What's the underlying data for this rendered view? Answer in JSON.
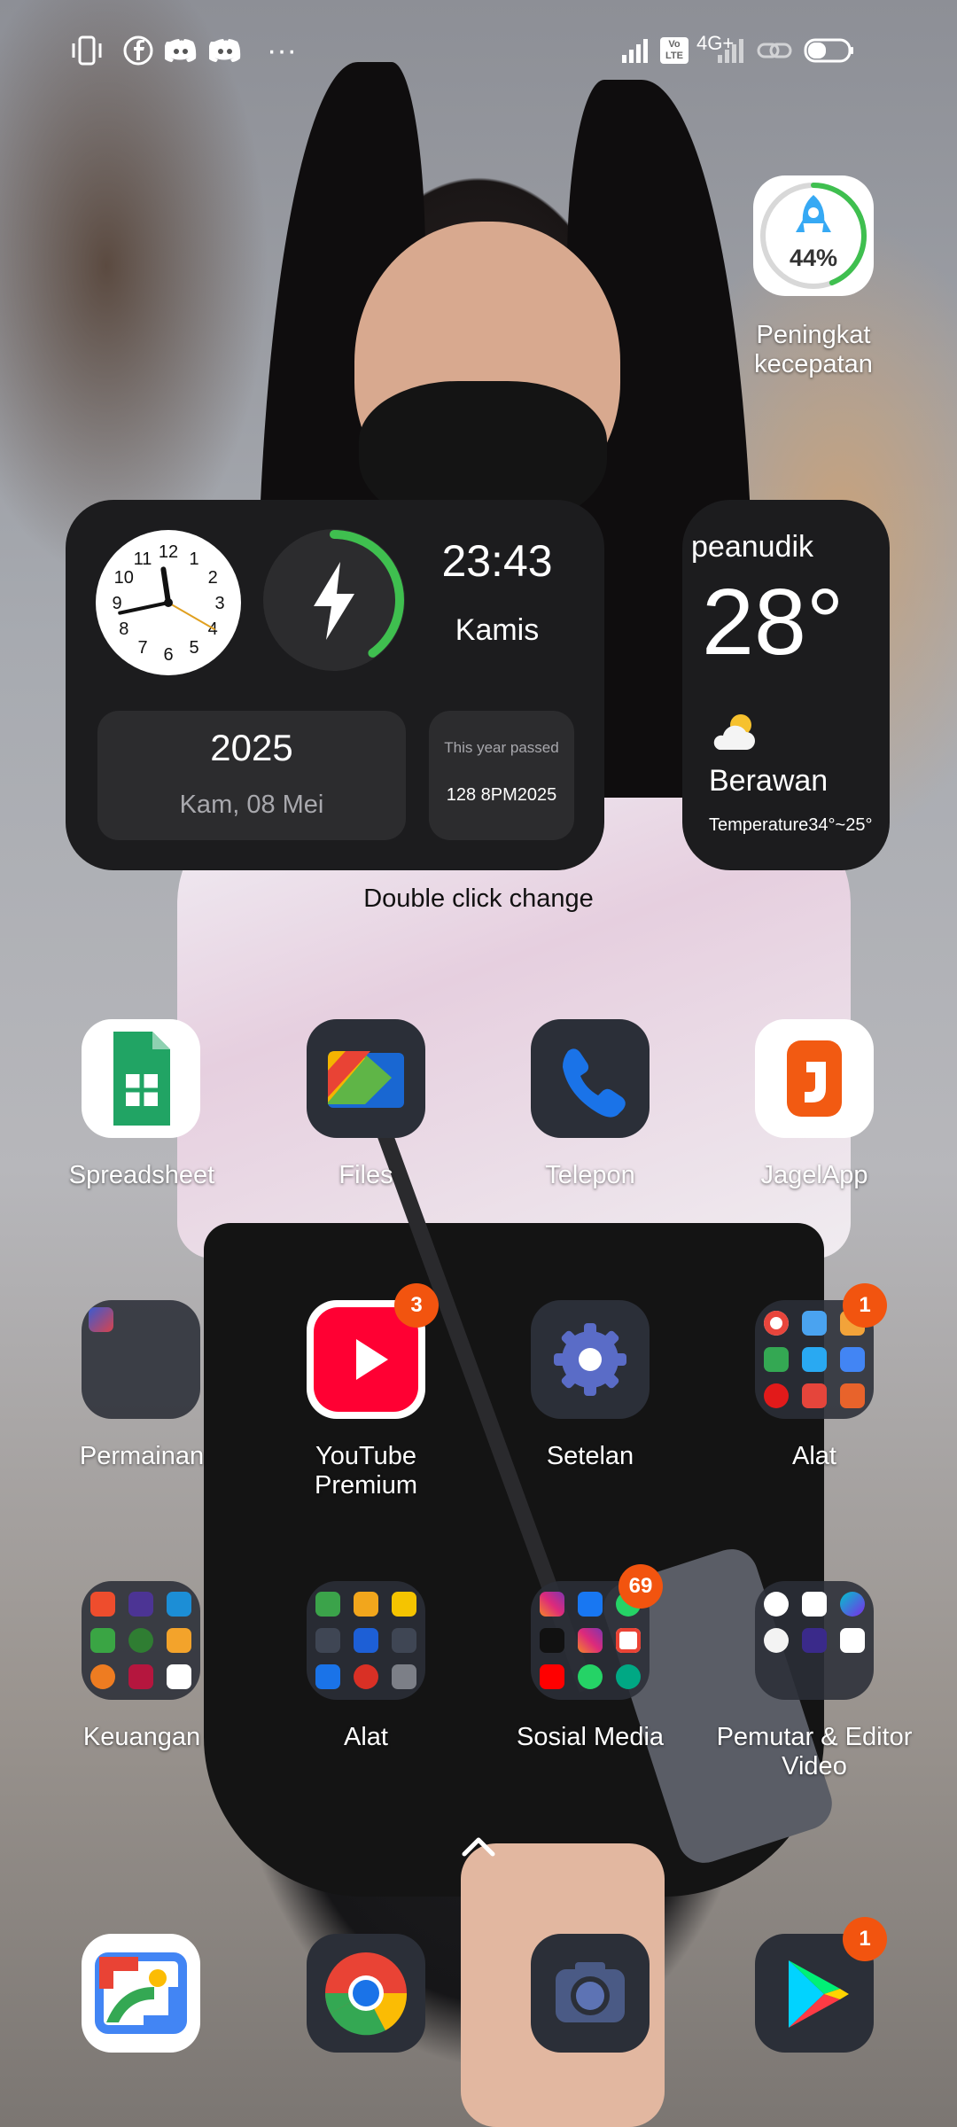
{
  "status_bar": {
    "left_icons": [
      "vibrate-icon",
      "facebook-icon",
      "discord-icon",
      "discord-icon",
      "more-icon"
    ],
    "more_dots": "···",
    "network_label": "Vo LTE",
    "network_type": "4G+",
    "right_icons": [
      "signal-icon",
      "volte-icon",
      "signal-icon",
      "link-icon",
      "battery-icon"
    ]
  },
  "booster_widget": {
    "percent": "44%",
    "progress": 0.44,
    "label": "Peningkat kecepatan"
  },
  "clock_widget": {
    "clock_numbers": [
      "12",
      "1",
      "2",
      "3",
      "4",
      "5",
      "6",
      "7",
      "8",
      "9",
      "10",
      "11"
    ],
    "time": "23:43",
    "day": "Kamis",
    "year": "2025",
    "date": "Kam, 08 Mei",
    "year_passed_title": "This year passed",
    "year_passed_value": "128 8PM2025",
    "battery_ring_progress": 0.4
  },
  "weather_widget": {
    "location": "peanudik",
    "temperature": "28°",
    "condition": "Berawan",
    "range": "Temperature34°~25°"
  },
  "hint": "Double click change",
  "apps_row1": [
    {
      "name": "Spreadsheet",
      "icon": "sheets-icon"
    },
    {
      "name": "Files",
      "icon": "files-icon"
    },
    {
      "name": "Telepon",
      "icon": "phone-icon"
    },
    {
      "name": "JagelApp",
      "icon": "jagel-icon"
    }
  ],
  "apps_row2": [
    {
      "name": "Permainan",
      "icon": "games-folder-icon"
    },
    {
      "name": "YouTube Premium",
      "icon": "youtube-icon",
      "badge": "3"
    },
    {
      "name": "Setelan",
      "icon": "settings-icon"
    },
    {
      "name": "Alat",
      "icon": "tools-folder-icon",
      "badge": "1"
    }
  ],
  "apps_row3": [
    {
      "name": "Keuangan",
      "icon": "finance-folder-icon"
    },
    {
      "name": "Alat",
      "icon": "tools-folder-icon"
    },
    {
      "name": "Sosial Media",
      "icon": "social-folder-icon",
      "badge": "69"
    },
    {
      "name": "Pemutar & Editor Video",
      "icon": "video-folder-icon"
    }
  ],
  "dock": [
    {
      "icon": "gallery-icon"
    },
    {
      "icon": "chrome-icon"
    },
    {
      "icon": "camera-icon"
    },
    {
      "icon": "play-store-icon",
      "badge": "1"
    }
  ],
  "colors": {
    "badge": "#f2540f",
    "widget_bg": "#1c1c1e",
    "ring_green": "#3fbf4f"
  }
}
